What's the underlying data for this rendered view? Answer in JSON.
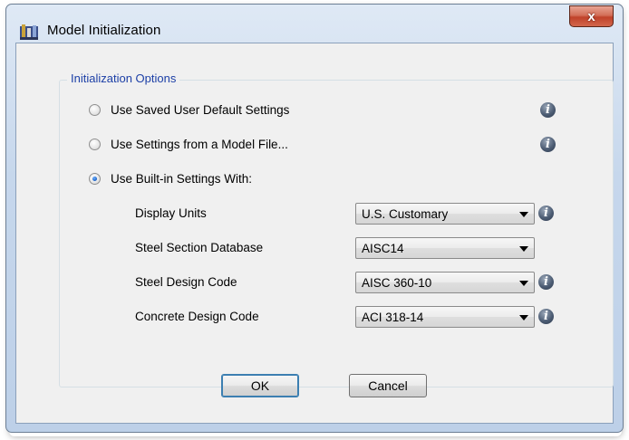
{
  "window": {
    "title": "Model Initialization",
    "close_glyph": "x"
  },
  "group": {
    "legend": "Initialization Options"
  },
  "options": [
    {
      "label": "Use Saved User Default Settings",
      "checked": false
    },
    {
      "label": "Use Settings from a Model File...",
      "checked": false
    },
    {
      "label": "Use Built-in Settings With:",
      "checked": true
    }
  ],
  "fields": [
    {
      "label": "Display Units",
      "value": "U.S. Customary",
      "has_info": true
    },
    {
      "label": "Steel Section Database",
      "value": "AISC14",
      "has_info": false
    },
    {
      "label": "Steel Design Code",
      "value": "AISC 360-10",
      "has_info": true
    },
    {
      "label": "Concrete Design Code",
      "value": "ACI 318-14",
      "has_info": true
    }
  ],
  "info_glyph": "i",
  "buttons": {
    "ok": "OK",
    "cancel": "Cancel"
  },
  "icons": {
    "app": "model-building-icon",
    "info": "info-icon",
    "dropdown": "chevron-down-icon"
  },
  "colors": {
    "legend_text": "#1c3fa6",
    "close_button": "#c0422a",
    "dialog_bg": "#f0f0f0"
  }
}
